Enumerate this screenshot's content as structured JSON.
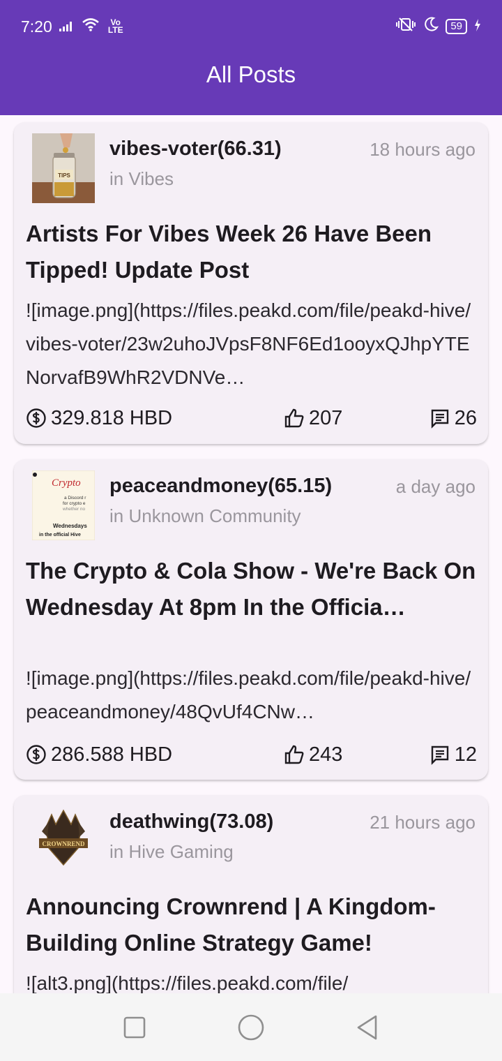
{
  "status_bar": {
    "time": "7:20",
    "network_label": "Vo LTE",
    "battery": "59"
  },
  "app_bar": {
    "title": "All Posts"
  },
  "posts": [
    {
      "author": "vibes-voter(66.31)",
      "time": "18 hours ago",
      "community": "in Vibes",
      "title": "Artists For Vibes Week 26 Have Been Tipped! Update Post",
      "body": "![image.png](https://files.peakd.com/file/peakd-hive/vibes-voter/23w2uhoJVpsF8NF6Ed1ooyxQJhpYTENorvafB9WhR2VDNVe…",
      "payout": "329.818 HBD",
      "votes": "207",
      "comments": "26",
      "thumb_text": "TIPS"
    },
    {
      "author": "peaceandmoney(65.15)",
      "time": "a day ago",
      "community": "in Unknown Community",
      "title": "The Crypto & Cola Show - We're Back On Wednesday At 8pm In the Officia…",
      "body": "![image.png](https://files.peakd.com/file/peakd-hive/peaceandmoney/48QvUf4CNw…",
      "payout": "286.588 HBD",
      "votes": "243",
      "comments": "12",
      "thumb_lines": [
        "Crypto",
        "a Discord r",
        "for crypto e",
        "whether no",
        "Wednesdays",
        "in the official Hive"
      ]
    },
    {
      "author": "deathwing(73.08)",
      "time": "21 hours ago",
      "community": "in Hive Gaming",
      "title": "Announcing Crownrend  | A Kingdom-Building Online Strategy Game!",
      "body": "![alt3.png](https://files.peakd.com/file/",
      "thumb_text": "CROWNREND"
    }
  ],
  "icons": {
    "payout": "dollar-circle-icon",
    "votes": "thumb-up-icon",
    "comments": "comment-icon"
  },
  "colors": {
    "app_bar": "#673ab7",
    "card_bg": "#f5eff6",
    "muted_text": "#9a969d"
  }
}
